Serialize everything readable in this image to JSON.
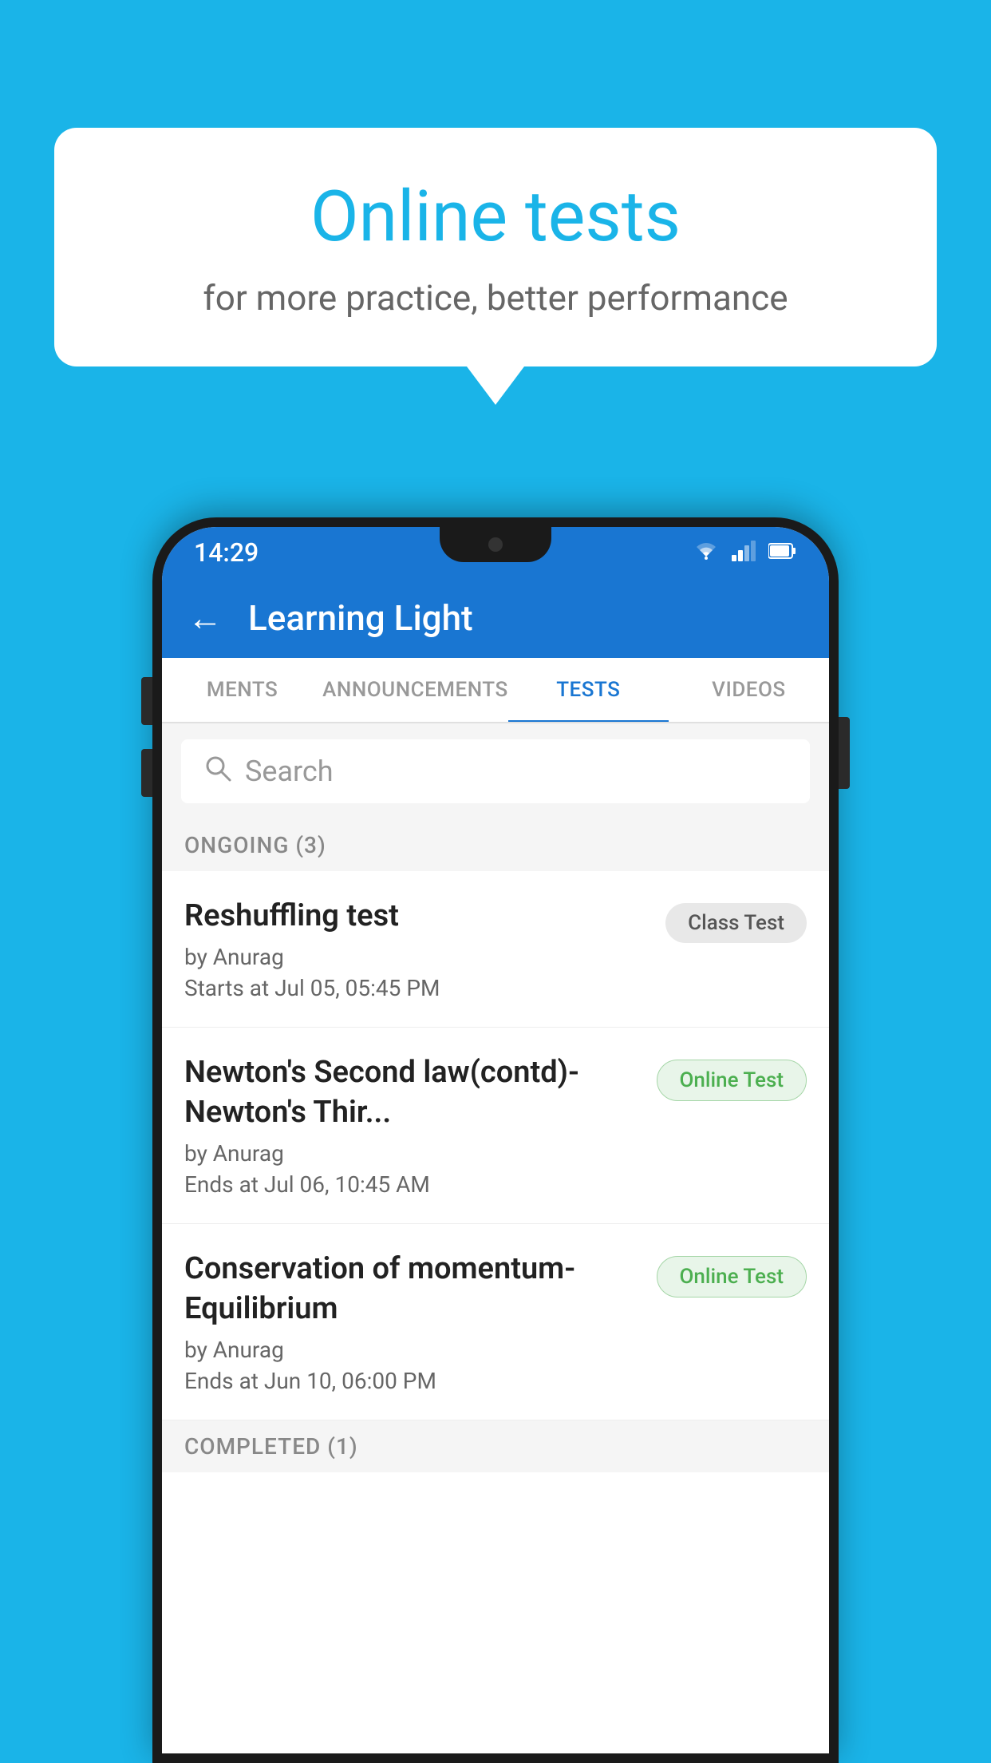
{
  "background_color": "#1ab4e8",
  "speech_bubble": {
    "title": "Online tests",
    "subtitle": "for more practice, better performance"
  },
  "phone": {
    "status_bar": {
      "time": "14:29",
      "icons": [
        "wifi",
        "signal",
        "battery"
      ]
    },
    "app_header": {
      "title": "Learning Light",
      "back_label": "←"
    },
    "tabs": [
      {
        "label": "MENTS",
        "active": false
      },
      {
        "label": "ANNOUNCEMENTS",
        "active": false
      },
      {
        "label": "TESTS",
        "active": true
      },
      {
        "label": "VIDEOS",
        "active": false
      }
    ],
    "search": {
      "placeholder": "Search"
    },
    "ongoing_section": {
      "label": "ONGOING (3)",
      "tests": [
        {
          "name": "Reshuffling test",
          "author": "by Anurag",
          "date": "Starts at  Jul 05, 05:45 PM",
          "badge": "Class Test",
          "badge_type": "class"
        },
        {
          "name": "Newton's Second law(contd)-Newton's Thir...",
          "author": "by Anurag",
          "date": "Ends at  Jul 06, 10:45 AM",
          "badge": "Online Test",
          "badge_type": "online"
        },
        {
          "name": "Conservation of momentum-Equilibrium",
          "author": "by Anurag",
          "date": "Ends at  Jun 10, 06:00 PM",
          "badge": "Online Test",
          "badge_type": "online"
        }
      ]
    },
    "completed_section": {
      "label": "COMPLETED (1)"
    }
  }
}
